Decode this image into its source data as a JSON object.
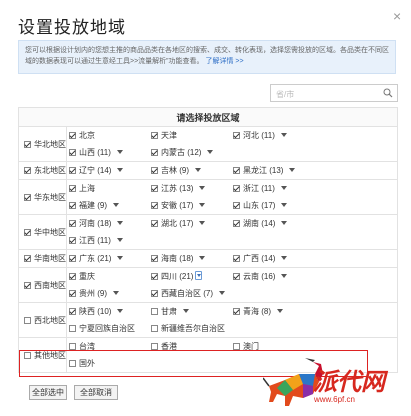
{
  "dialog": {
    "title": "设置投放地域",
    "close": "×"
  },
  "info": {
    "text": "您可以根据设计划内的您想主推的商品品类在各地区的搜索、成交、转化表现，选择您需投放的区域。各品类在不同区域的数据表现可以通过生意经工具>>流量解析”功能查看。",
    "link": "了解详情 >>"
  },
  "search": {
    "placeholder": "省/市"
  },
  "table": {
    "header": "请选择投放区域",
    "regions": [
      {
        "name": "华北地区",
        "checked": true,
        "provinces": [
          {
            "name": "北京",
            "count": "",
            "checked": true
          },
          {
            "name": "天津",
            "count": "",
            "checked": true
          },
          {
            "name": "河北",
            "count": "(11)",
            "checked": true,
            "arrow": true
          },
          {
            "name": "山西",
            "count": "(11)",
            "checked": true,
            "arrow": true
          },
          {
            "name": "内蒙古",
            "count": "(12)",
            "checked": true,
            "arrow": true
          }
        ]
      },
      {
        "name": "东北地区",
        "checked": true,
        "provinces": [
          {
            "name": "辽宁",
            "count": "(14)",
            "checked": true,
            "arrow": true
          },
          {
            "name": "吉林",
            "count": "(9)",
            "checked": true,
            "arrow": true
          },
          {
            "name": "黑龙江",
            "count": "(13)",
            "checked": true,
            "arrow": true
          }
        ]
      },
      {
        "name": "华东地区",
        "checked": true,
        "provinces": [
          {
            "name": "上海",
            "count": "",
            "checked": true
          },
          {
            "name": "江苏",
            "count": "(13)",
            "checked": true,
            "arrow": true
          },
          {
            "name": "浙江",
            "count": "(11)",
            "checked": true,
            "arrow": true
          },
          {
            "name": "福建",
            "count": "(9)",
            "checked": true,
            "arrow": true
          },
          {
            "name": "安徽",
            "count": "(17)",
            "checked": true,
            "arrow": true
          },
          {
            "name": "山东",
            "count": "(17)",
            "checked": true,
            "arrow": true
          }
        ]
      },
      {
        "name": "华中地区",
        "checked": true,
        "provinces": [
          {
            "name": "河南",
            "count": "(18)",
            "checked": true,
            "arrow": true
          },
          {
            "name": "湖北",
            "count": "(17)",
            "checked": true,
            "arrow": true
          },
          {
            "name": "湖南",
            "count": "(14)",
            "checked": true,
            "arrow": true
          },
          {
            "name": "江西",
            "count": "(11)",
            "checked": true,
            "arrow": true
          }
        ]
      },
      {
        "name": "华南地区",
        "checked": true,
        "provinces": [
          {
            "name": "广东",
            "count": "(21)",
            "checked": true,
            "arrow": true
          },
          {
            "name": "海南",
            "count": "(18)",
            "checked": true,
            "arrow": true
          },
          {
            "name": "广西",
            "count": "(14)",
            "checked": true,
            "arrow": true
          }
        ]
      },
      {
        "name": "西南地区",
        "checked": true,
        "provinces": [
          {
            "name": "重庆",
            "count": "",
            "checked": true
          },
          {
            "name": "四川",
            "count": "(21)",
            "checked": true,
            "arrow": "box"
          },
          {
            "name": "云南",
            "count": "(16)",
            "checked": true,
            "arrow": true
          },
          {
            "name": "贵州",
            "count": "(9)",
            "checked": true,
            "arrow": true
          },
          {
            "name": "西藏自治区",
            "count": "(7)",
            "checked": true,
            "arrow": true
          }
        ]
      },
      {
        "name": "西北地区",
        "checked": false,
        "provinces": [
          {
            "name": "陕西",
            "count": "(10)",
            "checked": true,
            "arrow": true
          },
          {
            "name": "甘肃",
            "count": "",
            "checked": false,
            "arrow": true
          },
          {
            "name": "青海",
            "count": "(8)",
            "checked": true,
            "arrow": true
          },
          {
            "name": "宁夏回族自治区",
            "count": "",
            "checked": false
          },
          {
            "name": "新疆维吾尔自治区",
            "count": "",
            "checked": false
          }
        ]
      },
      {
        "name": "其他地区",
        "checked": false,
        "provinces": [
          {
            "name": "台湾",
            "count": "",
            "checked": false
          },
          {
            "name": "香港",
            "count": "",
            "checked": false
          },
          {
            "name": "澳门",
            "count": "",
            "checked": false
          },
          {
            "name": "国外",
            "count": "",
            "checked": false
          }
        ]
      }
    ]
  },
  "buttons": {
    "select_all": "全部选中",
    "clear_all": "全部取消"
  },
  "watermark": {
    "brand": "派代网",
    "url": "www.6pf.cn"
  },
  "colors": {
    "accent": "#2f6fc6",
    "highlight": "#dd2222",
    "logo": "#d7281f"
  }
}
